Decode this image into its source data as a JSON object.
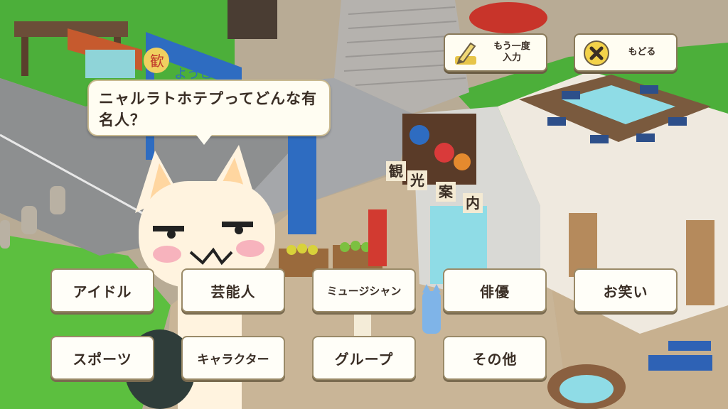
{
  "speech_bubble": {
    "text": "ニャルラトホテプってどんな有名人？"
  },
  "top_buttons": {
    "retry": {
      "label": "もう一度\n入力",
      "icon": "pencil-icon"
    },
    "back": {
      "label": "もどる",
      "icon": "close-circle-icon"
    }
  },
  "choices": [
    {
      "label": "アイドル"
    },
    {
      "label": "芸能人"
    },
    {
      "label": "ミュージシャン"
    },
    {
      "label": "俳優"
    },
    {
      "label": "お笑い"
    },
    {
      "label": "スポーツ"
    },
    {
      "label": "キャラクター"
    },
    {
      "label": "グループ"
    },
    {
      "label": "その他"
    }
  ],
  "scene": {
    "signs": {
      "tourist_info": [
        "観",
        "光",
        "案",
        "内"
      ],
      "banner_top": "歓",
      "banner_sub": "ようこ"
    }
  },
  "colors": {
    "button_face": "#fffef8",
    "button_border": "#9a8a68",
    "text": "#3a2e25",
    "grass": "#4caf3a",
    "pavement": "#a9a298"
  }
}
